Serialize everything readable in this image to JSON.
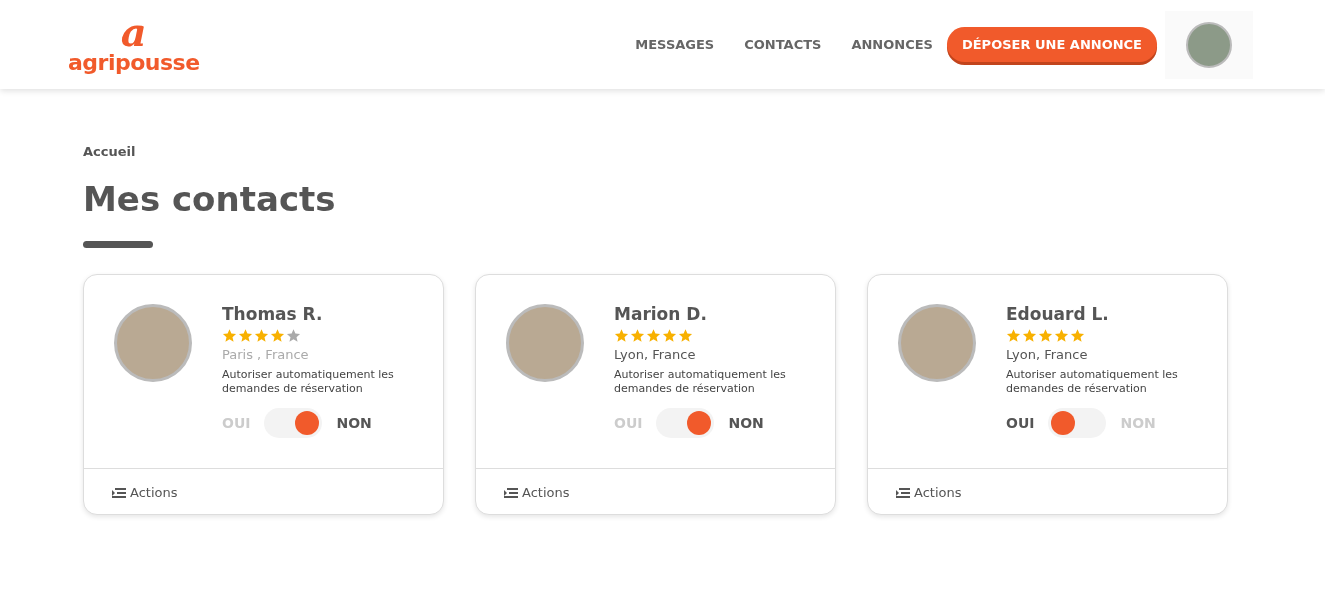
{
  "header": {
    "logo": {
      "mark": "a",
      "text": "agripousse"
    },
    "nav": [
      {
        "label": "MESSAGES"
      },
      {
        "label": "CONTACTS"
      },
      {
        "label": "ANNONCES"
      }
    ],
    "cta": "DÉPOSER UNE ANNONCE"
  },
  "breadcrumb": "Accueil",
  "title": "Mes contacts",
  "contacts": [
    {
      "name": "Thomas R.",
      "stars": 4,
      "location": "Paris , France",
      "setting": "Autoriser automatiquement les demandes de réservation",
      "yes": "OUI",
      "no": "NON",
      "no_selected": true,
      "actions": "Actions"
    },
    {
      "name": "Marion D.",
      "stars": 5,
      "location": "Lyon, France",
      "setting": "Autoriser automatiquement les demandes de réservation",
      "yes": "OUI",
      "no": "NON",
      "no_selected": true,
      "actions": "Actions"
    },
    {
      "name": "Edouard L.",
      "stars": 5,
      "location": "Lyon, France",
      "setting": "Autoriser automatiquement les demandes de réservation",
      "yes": "OUI",
      "no": "NON",
      "no_selected": false,
      "actions": "Actions"
    }
  ]
}
